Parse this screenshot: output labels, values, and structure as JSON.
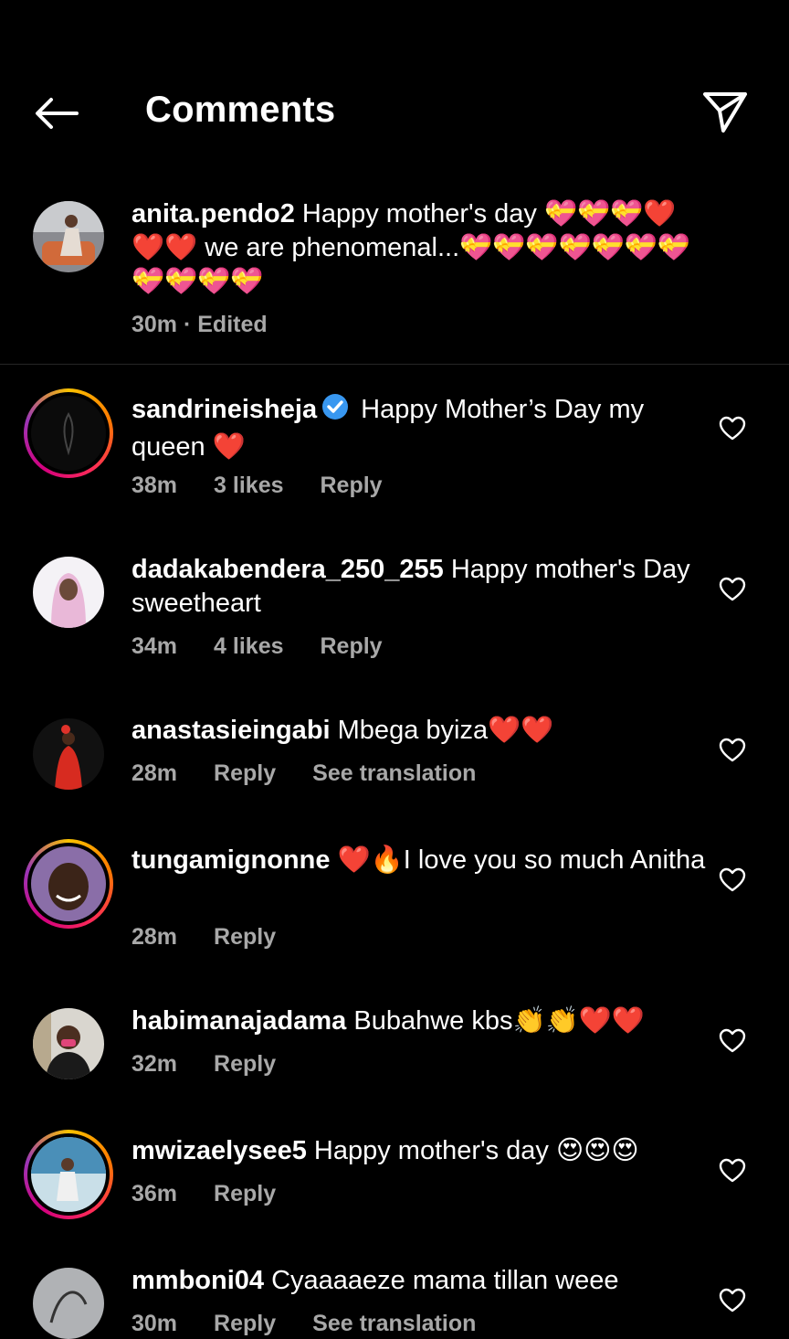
{
  "header": {
    "title": "Comments"
  },
  "caption": {
    "username": "anita.pendo2",
    "text": " Happy mother's day 💝💝💝❤️❤️❤️ we are phenomenal...💝💝💝💝💝💝💝💝💝💝💝",
    "time": "30m · Edited"
  },
  "comments": [
    {
      "username": "sandrineisheja",
      "verified": true,
      "text": " Happy Mother’s Day my queen ❤️",
      "time": "38m",
      "likes": "3 likes",
      "reply": "Reply",
      "extra": ""
    },
    {
      "username": "dadakabendera_250_255",
      "text": " Happy mother's Day sweetheart",
      "time": "34m",
      "likes": "4 likes",
      "reply": "Reply",
      "extra": ""
    },
    {
      "username": "anastasieingabi",
      "text": " Mbega byiza❤️❤️",
      "time": "28m",
      "likes": "",
      "reply": "Reply",
      "extra": "See translation"
    },
    {
      "username": "tungamignonne",
      "text": " ❤️🔥I love you so much Anitha",
      "time": "28m",
      "likes": "",
      "reply": "Reply",
      "extra": ""
    },
    {
      "username": "habimanajadama",
      "text": " Bubahwe kbs👏👏❤️❤️",
      "time": "32m",
      "likes": "",
      "reply": "Reply",
      "extra": ""
    },
    {
      "username": "mwizaelysee5",
      "text": " Happy mother's day 😍😍😍",
      "time": "36m",
      "likes": "",
      "reply": "Reply",
      "extra": ""
    },
    {
      "username": "mmboni04",
      "text": " Cyaaaaeze mama tillan weee",
      "time": "30m",
      "likes": "",
      "reply": "Reply",
      "extra": "See translation"
    }
  ],
  "colors": {
    "background": "#000000",
    "meta": "#a8a8a8",
    "verified": "#3897f0",
    "heart": "#ff3040"
  }
}
